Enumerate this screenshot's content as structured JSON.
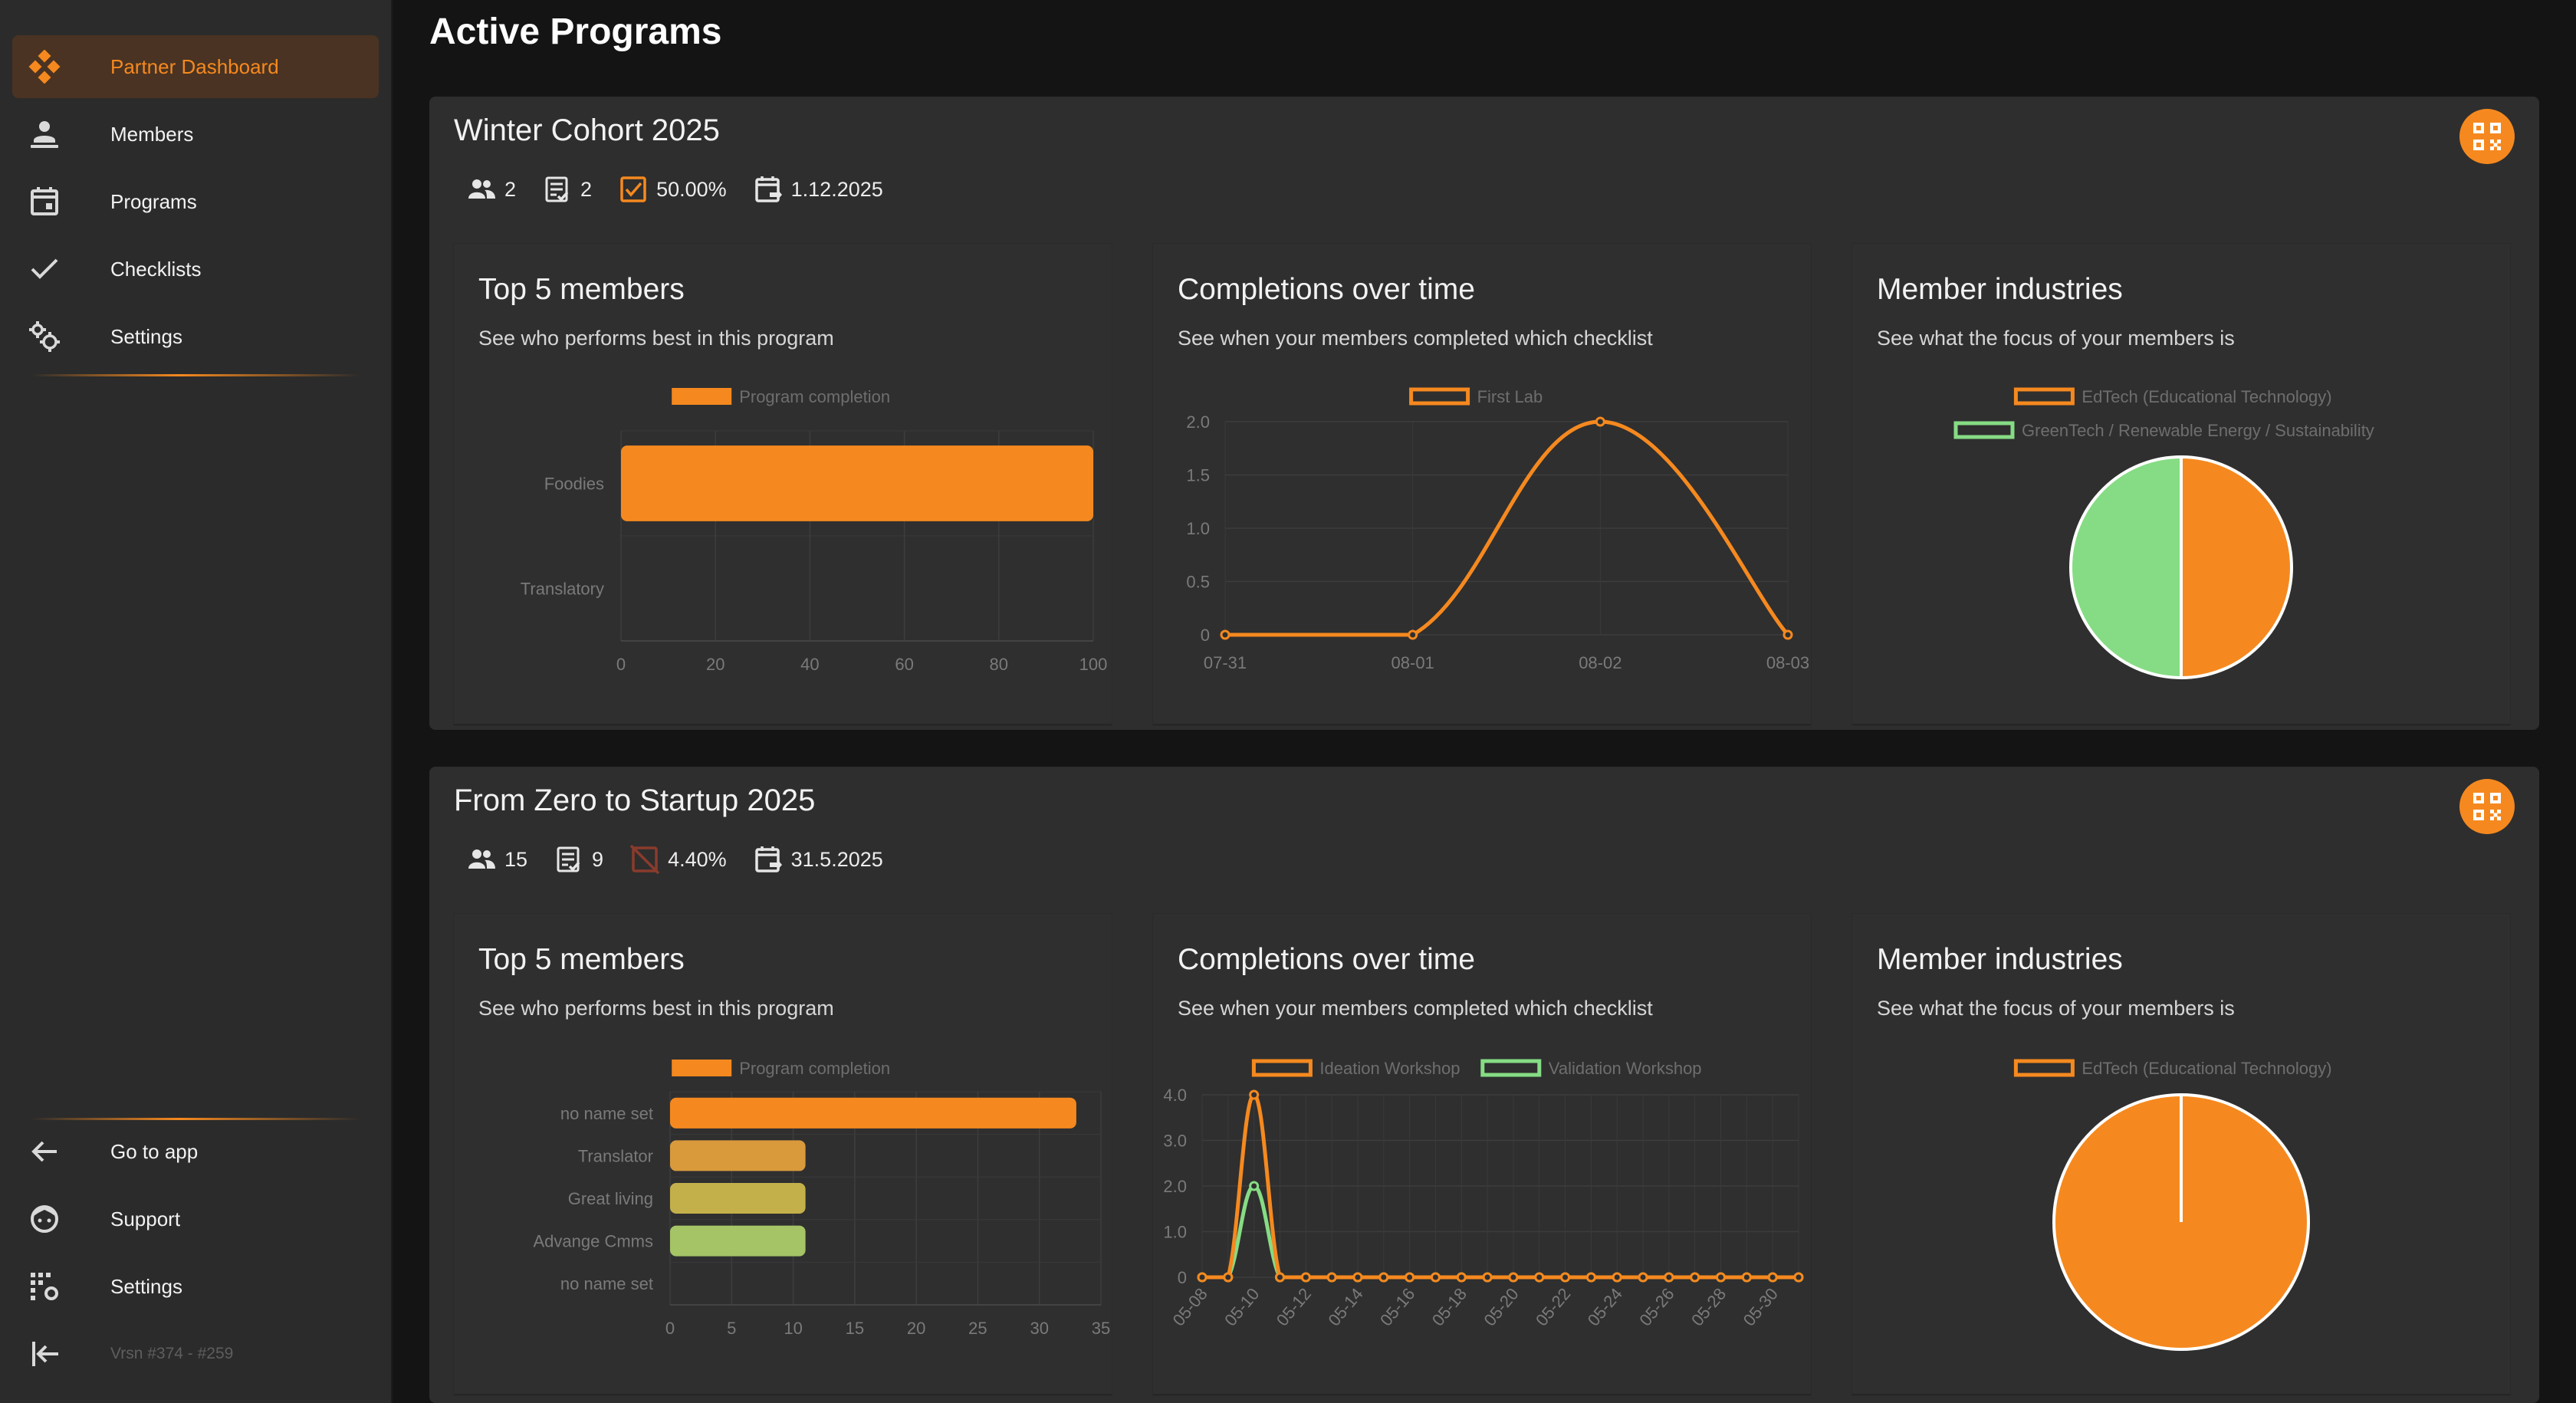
{
  "sidebar": {
    "top_items": [
      {
        "label": "Partner Dashboard",
        "icon": "dashboard-icon"
      },
      {
        "label": "Members",
        "icon": "members-icon"
      },
      {
        "label": "Programs",
        "icon": "calendar-icon"
      },
      {
        "label": "Checklists",
        "icon": "checkmark-icon"
      },
      {
        "label": "Settings",
        "icon": "gears-icon"
      }
    ],
    "bottom_items": [
      {
        "label": "Go to app",
        "icon": "arrow-left-icon"
      },
      {
        "label": "Support",
        "icon": "support-icon"
      },
      {
        "label": "Settings",
        "icon": "building-settings-icon"
      }
    ],
    "version": "Vrsn #374 - #259",
    "accent": "#f5891f"
  },
  "page": {
    "title": "Active Programs"
  },
  "programs": [
    {
      "name": "Winter Cohort 2025",
      "stats": {
        "members": "2",
        "checklists": "2",
        "completion": "50.00%",
        "date": "1.12.2025"
      },
      "completion_status": "complete-checkbox",
      "panels": {
        "top_members": {
          "title": "Top 5 members",
          "subtitle": "See who performs best in this program"
        },
        "completions": {
          "title": "Completions over time",
          "subtitle": "See when your members completed which checklist"
        },
        "industries": {
          "title": "Member industries",
          "subtitle": "See what the focus of your members is"
        }
      }
    },
    {
      "name": "From Zero to Startup 2025",
      "stats": {
        "members": "15",
        "checklists": "9",
        "completion": "4.40%",
        "date": "31.5.2025"
      },
      "completion_status": "incomplete-checkbox",
      "panels": {
        "top_members": {
          "title": "Top 5 members",
          "subtitle": "See who performs best in this program"
        },
        "completions": {
          "title": "Completions over time",
          "subtitle": "See when your members completed which checklist"
        },
        "industries": {
          "title": "Member industries",
          "subtitle": "See what the focus of your members is"
        }
      }
    }
  ],
  "chart_data": [
    {
      "id": "p1-top-members",
      "type": "bar",
      "orientation": "horizontal",
      "categories": [
        "Foodies",
        "Translatory"
      ],
      "series": [
        {
          "name": "Program completion",
          "values": [
            100,
            0
          ]
        }
      ],
      "xlim": [
        0,
        100
      ],
      "xticks": [
        0,
        20,
        40,
        60,
        80,
        100
      ],
      "colors": [
        "#f5891f"
      ],
      "legend": "top"
    },
    {
      "id": "p1-completions",
      "type": "line",
      "x": [
        "07-31",
        "08-01",
        "08-02",
        "08-03"
      ],
      "series": [
        {
          "name": "First Lab",
          "values": [
            0,
            0,
            2,
            0
          ],
          "color": "#f5891f"
        }
      ],
      "ylim": [
        0,
        2
      ],
      "yticks": [
        "0",
        "0.5",
        "1.0",
        "1.5",
        "2.0"
      ],
      "grid": true,
      "legend": "top"
    },
    {
      "id": "p1-industries",
      "type": "pie",
      "labels": [
        "EdTech (Educational Technology)",
        "GreenTech / Renewable Energy / Sustainability"
      ],
      "values": [
        1,
        1
      ],
      "colors": [
        "#f5891f",
        "#86dc84"
      ],
      "legend": "top"
    },
    {
      "id": "p2-top-members",
      "type": "bar",
      "orientation": "horizontal",
      "categories": [
        "no name set",
        "Translator",
        "Great living",
        "Advange Cmms",
        "no name set"
      ],
      "series": [
        {
          "name": "Program completion",
          "values": [
            33,
            11,
            11,
            11,
            0
          ]
        }
      ],
      "xlim": [
        0,
        35
      ],
      "xticks": [
        0,
        5,
        10,
        15,
        20,
        25,
        30,
        35
      ],
      "colors": [
        "#f5891f",
        "#d99a3c",
        "#c4b04a",
        "#a5c466",
        "#8fd07a"
      ],
      "legend": "top"
    },
    {
      "id": "p2-completions",
      "type": "line",
      "x": [
        "05-08",
        "05-09",
        "05-10",
        "05-11",
        "05-12",
        "05-13",
        "05-14",
        "05-15",
        "05-16",
        "05-17",
        "05-18",
        "05-19",
        "05-20",
        "05-21",
        "05-22",
        "05-23",
        "05-24",
        "05-25",
        "05-26",
        "05-27",
        "05-28",
        "05-29",
        "05-30",
        "05-31"
      ],
      "xtick_labels": [
        "05-08",
        "05-10",
        "05-12",
        "05-14",
        "05-16",
        "05-18",
        "05-20",
        "05-22",
        "05-24",
        "05-26",
        "05-28",
        "05-30"
      ],
      "series": [
        {
          "name": "Ideation Workshop",
          "values": [
            0,
            0,
            4,
            0,
            0,
            0,
            0,
            0,
            0,
            0,
            0,
            0,
            0,
            0,
            0,
            0,
            0,
            0,
            0,
            0,
            0,
            0,
            0,
            0
          ],
          "color": "#f5891f"
        },
        {
          "name": "Validation Workshop",
          "values": [
            0,
            0,
            2,
            0,
            0,
            0,
            0,
            0,
            0,
            0,
            0,
            0,
            0,
            0,
            0,
            0,
            0,
            0,
            0,
            0,
            0,
            0,
            0,
            0
          ],
          "color": "#86dc84"
        }
      ],
      "ylim": [
        0,
        4
      ],
      "yticks": [
        "0",
        "1.0",
        "2.0",
        "3.0",
        "4.0"
      ],
      "grid": true,
      "legend": "top"
    },
    {
      "id": "p2-industries",
      "type": "pie",
      "labels": [
        "EdTech (Educational Technology)"
      ],
      "values": [
        1
      ],
      "colors": [
        "#f5891f"
      ],
      "legend": "top"
    }
  ]
}
